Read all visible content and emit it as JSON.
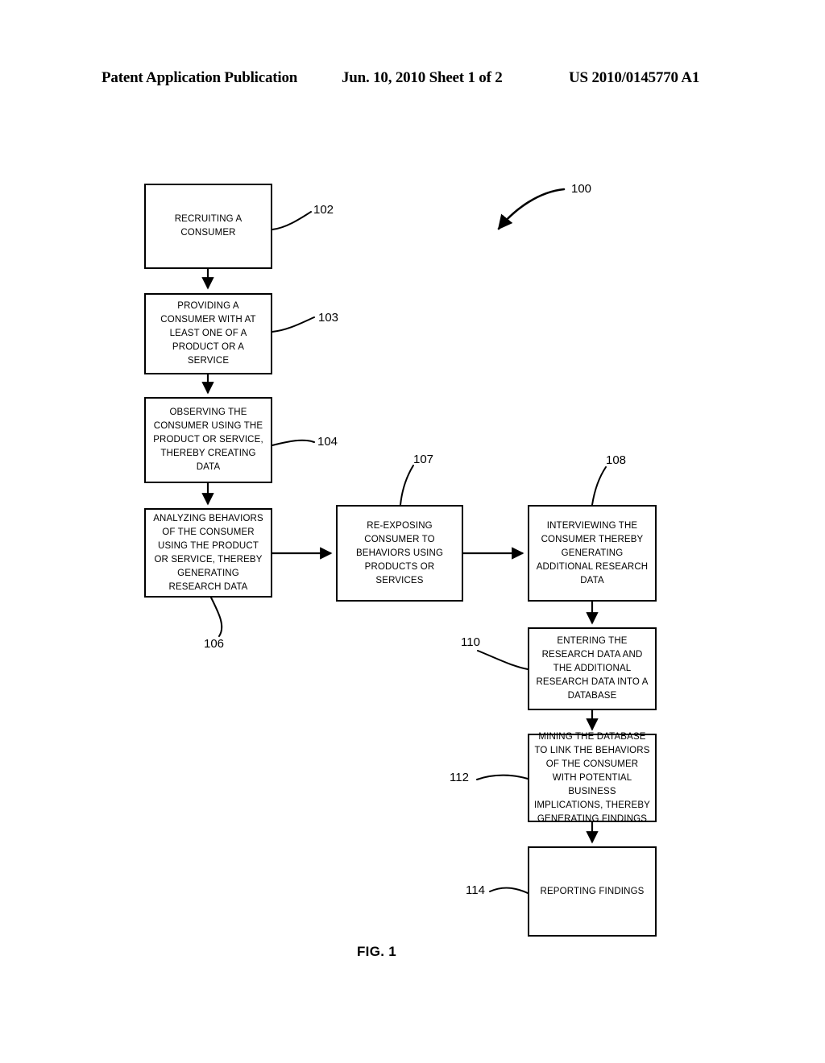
{
  "header": {
    "left": "Patent Application Publication",
    "middle": "Jun. 10, 2010  Sheet 1 of 2",
    "right": "US 2010/0145770 A1"
  },
  "figure": {
    "caption": "FIG. 1",
    "overall_ref": "100",
    "nodes": [
      {
        "ref": "102",
        "text": "RECRUITING A CONSUMER"
      },
      {
        "ref": "103",
        "text": "PROVIDING A CONSUMER WITH AT LEAST ONE OF A PRODUCT OR A SERVICE"
      },
      {
        "ref": "104",
        "text": "OBSERVING THE CONSUMER USING THE PRODUCT OR SERVICE, THEREBY CREATING DATA"
      },
      {
        "ref": "106",
        "text": "ANALYZING BEHAVIORS OF THE CONSUMER USING THE PRODUCT OR SERVICE, THEREBY GENERATING RESEARCH DATA"
      },
      {
        "ref": "107",
        "text": "RE-EXPOSING CONSUMER TO BEHAVIORS USING PRODUCTS OR SERVICES"
      },
      {
        "ref": "108",
        "text": "INTERVIEWING THE CONSUMER THEREBY GENERATING ADDITIONAL RESEARCH DATA"
      },
      {
        "ref": "110",
        "text": "ENTERING THE RESEARCH DATA AND THE ADDITIONAL RESEARCH DATA INTO A DATABASE"
      },
      {
        "ref": "112",
        "text": "MINING THE DATABASE TO LINK THE BEHAVIORS OF THE CONSUMER WITH POTENTIAL BUSINESS IMPLICATIONS, THEREBY GENERATING FINDINGS"
      },
      {
        "ref": "114",
        "text": "REPORTING FINDINGS"
      }
    ]
  },
  "colors": {
    "ink": "#000000",
    "paper": "#ffffff"
  }
}
